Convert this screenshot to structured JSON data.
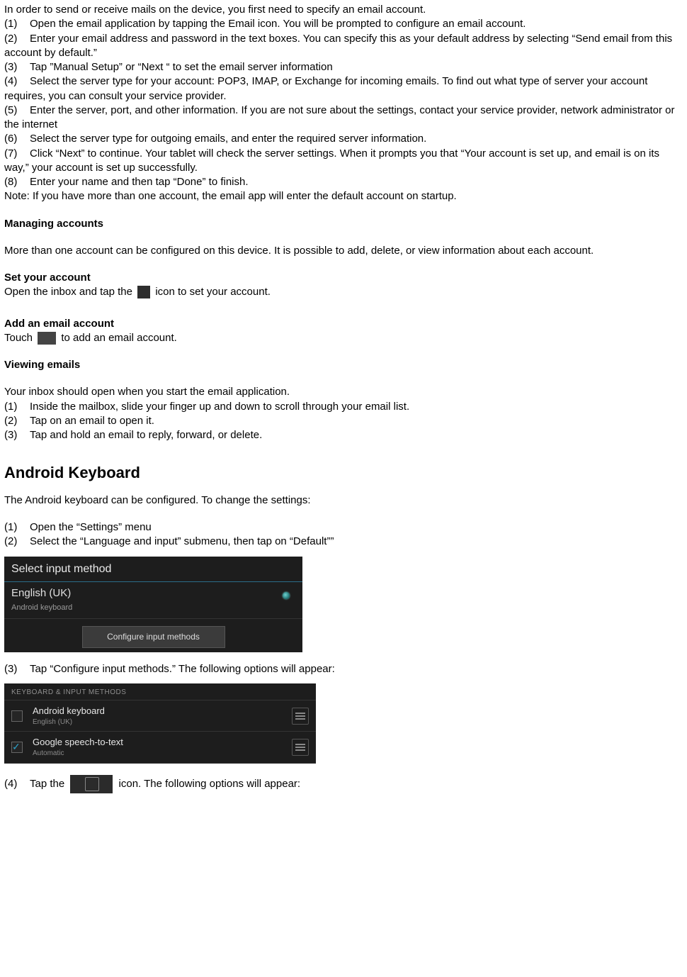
{
  "email": {
    "intro": "In order to send or receive mails on the device, you first need to specify an email account.",
    "steps": [
      "Open the email application by tapping the Email icon. You will be prompted to configure an email account.",
      "Enter your email address and password in the text boxes. You can specify this as your default address by selecting “Send email from this account by default.”",
      "Tap ”Manual Setup” or “Next “ to set the email server information",
      "Select the server type for your account: POP3, IMAP, or Exchange for incoming emails. To find out what type of server your account requires, you can consult your service provider.",
      "Enter the server, port, and other information. If you are not sure about the settings, contact your service provider, network administrator or the internet",
      "Select the server type for outgoing emails, and enter the required server information.",
      "Click “Next” to continue. Your tablet will check the server settings. When it prompts you that “Your account is set up, and email is on its way,” your account is set up successfully.",
      "Enter your name and then tap “Done” to finish."
    ],
    "note": "Note: If you have more than one account, the email app will enter the default account on startup.",
    "managing_title": "Managing accounts",
    "managing_body": "More than one account can be configured on this device. It is possible to add, delete, or view information about each account.",
    "set_title": "Set your account",
    "set_pre": "Open the inbox and tap the ",
    "set_post": " icon to set your account.",
    "add_title": "Add an email account",
    "add_pre": "Touch ",
    "add_post": "  to add an email account.",
    "view_title": "Viewing emails",
    "view_intro": "Your inbox should open when you start the email application.",
    "view_steps": [
      "Inside the mailbox, slide your finger up and down to scroll through your email list.",
      "Tap on an email to open it.",
      "Tap and hold an email to reply, forward, or delete."
    ]
  },
  "keyboard": {
    "title": "Android Keyboard",
    "intro": "The Android keyboard can be configured. To change the settings:",
    "steps_a": [
      "Open the “Settings” menu",
      "Select the “Language and input” submenu, then tap on “Default””"
    ],
    "img1": {
      "header": "Select input method",
      "opt_title": "English (UK)",
      "opt_sub": "Android keyboard",
      "button": "Configure input methods"
    },
    "step3": "Tap “Configure input methods.” The following options will appear:",
    "img2": {
      "header": "KEYBOARD & INPUT METHODS",
      "row1_title": "Android keyboard",
      "row1_sub": "English (UK)",
      "row2_title": "Google speech-to-text",
      "row2_sub": "Automatic"
    },
    "step4_pre": "Tap the ",
    "step4_post": " icon. The following options will appear:"
  }
}
